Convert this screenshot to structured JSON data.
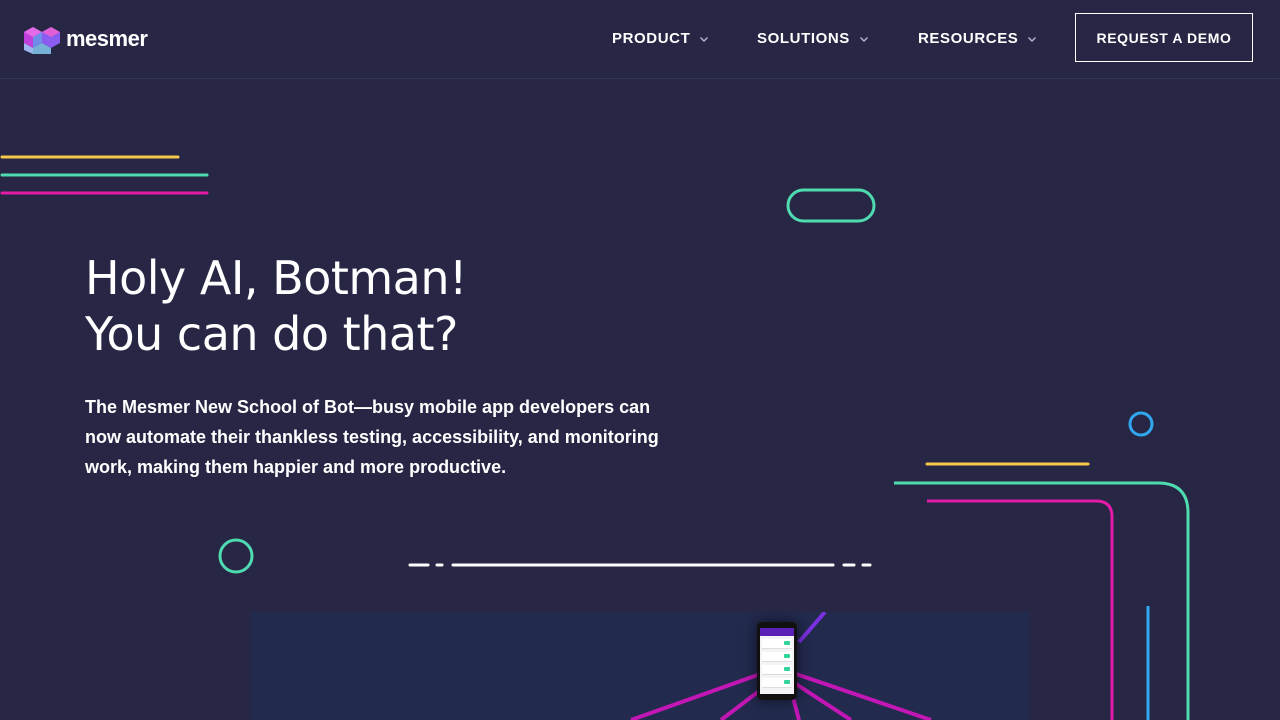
{
  "brand": {
    "name": "mesmer"
  },
  "nav": {
    "items": [
      {
        "label": "PRODUCT",
        "icon": "chevron-down-icon"
      },
      {
        "label": "SOLUTIONS",
        "icon": "chevron-down-icon"
      },
      {
        "label": "RESOURCES",
        "icon": "chevron-down-icon"
      }
    ],
    "cta_label": "REQUEST A DEMO"
  },
  "hero": {
    "title_line1": "Holy AI, Botman!",
    "title_line2": "You can do that?",
    "description": "The Mesmer New School of Bot—busy mobile app developers can now automate their thankless testing, accessibility, and monitoring work, making them happier and more productive."
  },
  "colors": {
    "background": "#272645",
    "accent_yellow": "#f4c84b",
    "accent_green": "#4fdbb0",
    "accent_magenta": "#e21ba8",
    "accent_blue": "#2fa8f0"
  }
}
